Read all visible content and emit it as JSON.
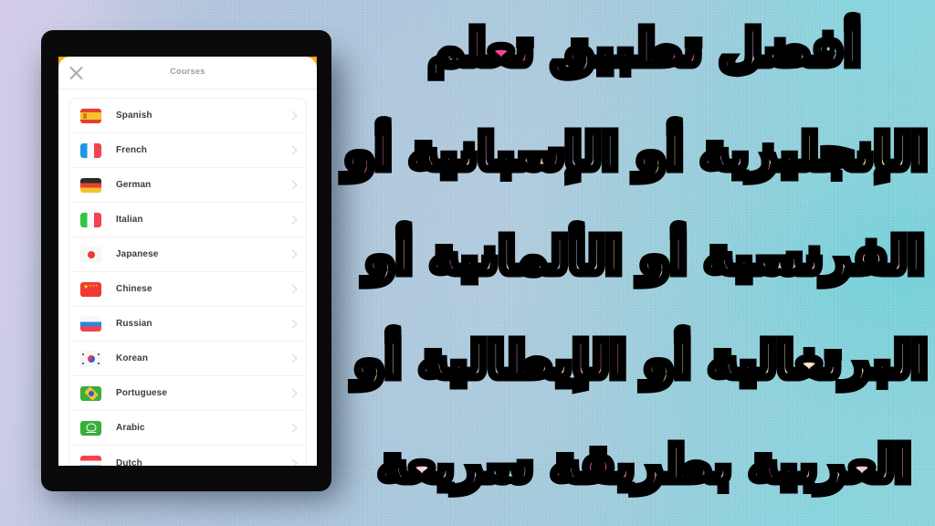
{
  "background": {
    "gradient_left": "#cfc6e8",
    "gradient_mid": "#a9c0da",
    "gradient_right": "#7ed2dc"
  },
  "phone": {
    "frame_color": "#0a0a0a",
    "sheet_accent": "#f9a81c",
    "nav": {
      "close_icon": "close-icon",
      "title": "Courses"
    },
    "courses": [
      {
        "label": "Spanish",
        "flag": "es",
        "chevron": "chevron-right-icon"
      },
      {
        "label": "French",
        "flag": "fr",
        "chevron": "chevron-right-icon"
      },
      {
        "label": "German",
        "flag": "de",
        "chevron": "chevron-right-icon"
      },
      {
        "label": "Italian",
        "flag": "it",
        "chevron": "chevron-right-icon"
      },
      {
        "label": "Japanese",
        "flag": "jp",
        "chevron": "chevron-right-icon"
      },
      {
        "label": "Chinese",
        "flag": "cn",
        "chevron": "chevron-right-icon"
      },
      {
        "label": "Russian",
        "flag": "ru",
        "chevron": "chevron-right-icon"
      },
      {
        "label": "Korean",
        "flag": "kr",
        "chevron": "chevron-right-icon"
      },
      {
        "label": "Portuguese",
        "flag": "br",
        "chevron": "chevron-right-icon"
      },
      {
        "label": "Arabic",
        "flag": "sa",
        "chevron": "chevron-right-icon"
      },
      {
        "label": "Dutch",
        "flag": "nl",
        "chevron": "chevron-right-icon"
      }
    ]
  },
  "headline": {
    "lines": [
      "أفضل تطبيق تعلم",
      "الإنجليزية أو الإسبانية أو",
      "الفرنسية أو الألمانية أو",
      "البرتغالية أو الإيطالية أو",
      "العربية بطريقة سريعة"
    ],
    "full_text": "أفضل تطبيق تعلم الإنجليزية أو الإسبانية أو الفرنسية أو الألمانية أو البرتغالية أو الإيطالية أو العربية بطريقة سريعة",
    "outline_color": "#000000"
  }
}
